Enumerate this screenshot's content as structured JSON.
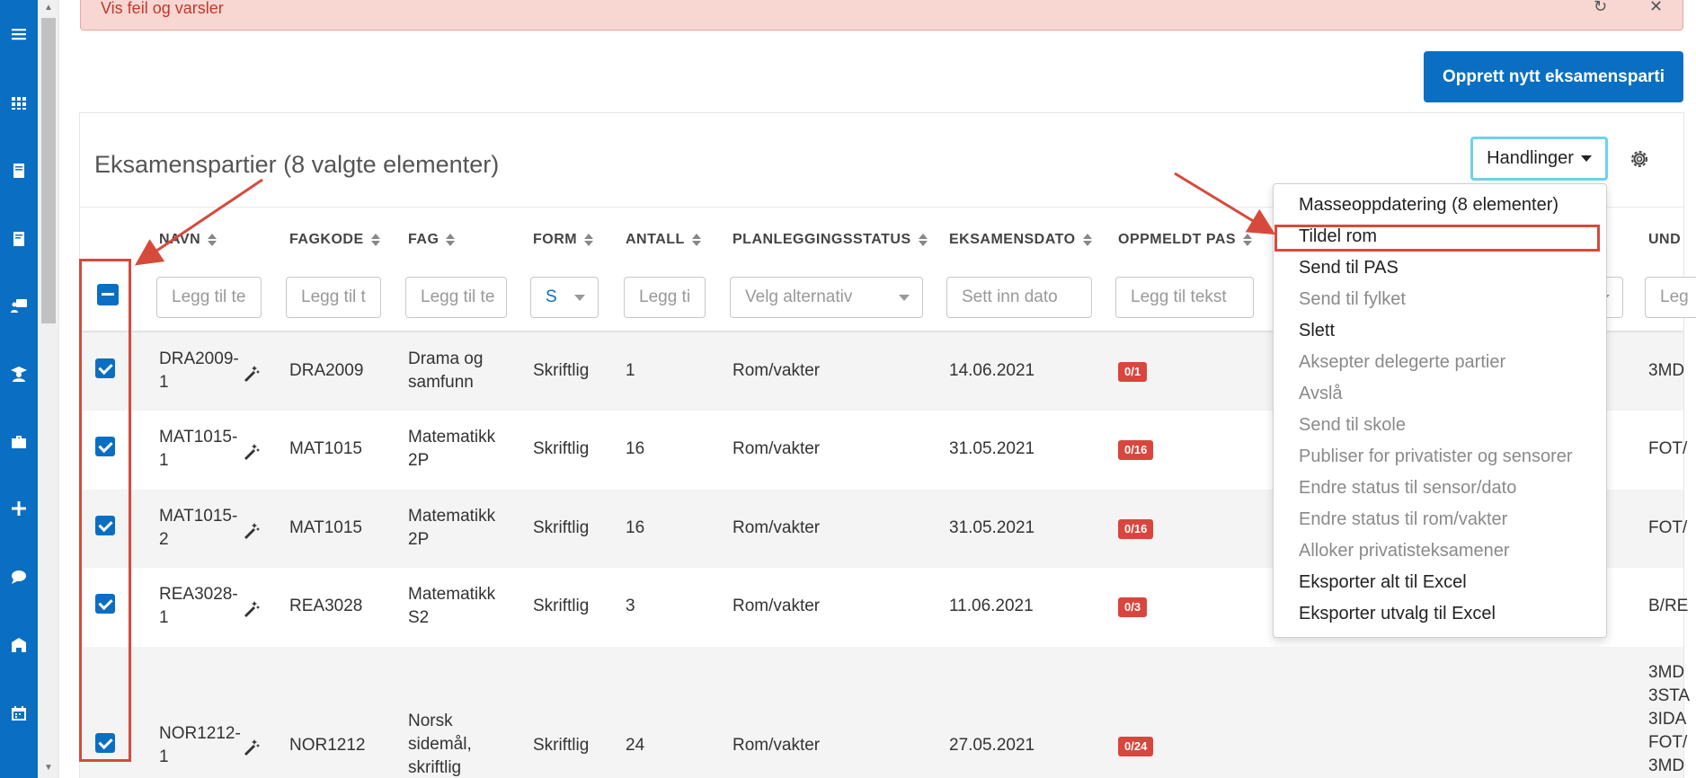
{
  "alert": {
    "text": "Vis feil og varsler"
  },
  "create_button": "Opprett nytt eksamensparti",
  "card": {
    "title": "Eksamenspartier (8 valgte elementer)"
  },
  "actions_button": "Handlinger",
  "columns": [
    "NAVN",
    "FAGKODE",
    "FAG",
    "FORM",
    "ANTALL",
    "PLANLEGGINGSSTATUS",
    "EKSAMENSDATO",
    "OPPMELDT PAS",
    "UND"
  ],
  "filters": {
    "navn": "Legg til te",
    "fagkode": "Legg til t",
    "fag": "Legg til te",
    "form": "S",
    "antall": "Legg ti",
    "status": "Velg alternativ",
    "dato": "Sett inn dato",
    "pas": "Legg til tekst",
    "und": "Leg"
  },
  "rows": [
    {
      "navn1": "DRA2009-",
      "navn2": "1",
      "fagkode": "DRA2009",
      "fag1": "Drama og",
      "fag2": "samfunn",
      "fag3": "",
      "form": "Skriftlig",
      "antall": "1",
      "status": "Rom/vakter",
      "dato": "14.06.2021",
      "pas": "0/1",
      "und": [
        "3MD"
      ]
    },
    {
      "navn1": "MAT1015-",
      "navn2": "1",
      "fagkode": "MAT1015",
      "fag1": "Matematikk",
      "fag2": "2P",
      "fag3": "",
      "form": "Skriftlig",
      "antall": "16",
      "status": "Rom/vakter",
      "dato": "31.05.2021",
      "pas": "0/16",
      "und": [
        "FOT/"
      ]
    },
    {
      "navn1": "MAT1015-",
      "navn2": "2",
      "fagkode": "MAT1015",
      "fag1": "Matematikk",
      "fag2": "2P",
      "fag3": "",
      "form": "Skriftlig",
      "antall": "16",
      "status": "Rom/vakter",
      "dato": "31.05.2021",
      "pas": "0/16",
      "und": [
        "FOT/"
      ]
    },
    {
      "navn1": "REA3028-",
      "navn2": "1",
      "fagkode": "REA3028",
      "fag1": "Matematikk",
      "fag2": "S2",
      "fag3": "",
      "form": "Skriftlig",
      "antall": "3",
      "status": "Rom/vakter",
      "dato": "11.06.2021",
      "pas": "0/3",
      "und": [
        "B/RE"
      ]
    },
    {
      "navn1": "NOR1212-",
      "navn2": "1",
      "fagkode": "NOR1212",
      "fag1": "Norsk",
      "fag2": "sidemål,",
      "fag3": "skriftlig",
      "form": "Skriftlig",
      "antall": "24",
      "status": "Rom/vakter",
      "dato": "27.05.2021",
      "pas": "0/24",
      "und": [
        "3MD",
        "3STA",
        "3IDA",
        "FOT/",
        "3MD"
      ]
    }
  ],
  "dropdown": [
    {
      "label": "Masseoppdatering (8 elementer)",
      "enabled": true
    },
    {
      "label": "Tildel rom",
      "enabled": true
    },
    {
      "label": "Send til PAS",
      "enabled": true
    },
    {
      "label": "Send til fylket",
      "enabled": false
    },
    {
      "label": "Slett",
      "enabled": true
    },
    {
      "label": "Aksepter delegerte partier",
      "enabled": false
    },
    {
      "label": "Avslå",
      "enabled": false
    },
    {
      "label": "Send til skole",
      "enabled": false
    },
    {
      "label": "Publiser for privatister og sensorer",
      "enabled": false
    },
    {
      "label": "Endre status til sensor/dato",
      "enabled": false
    },
    {
      "label": "Endre status til rom/vakter",
      "enabled": false
    },
    {
      "label": "Alloker privatisteksamener",
      "enabled": false
    },
    {
      "label": "Eksporter alt til Excel",
      "enabled": true
    },
    {
      "label": "Eksporter utvalg til Excel",
      "enabled": true
    }
  ],
  "sidebar_icons": [
    "menu-icon",
    "apps-grid-icon",
    "book-icon",
    "book-open-icon",
    "teacher-icon",
    "graduate-icon",
    "briefcase-icon",
    "plus-icon",
    "chat-icon",
    "school-icon",
    "calendar-icon"
  ],
  "colors": {
    "primary": "#0a6fc2",
    "badge": "#d9463d",
    "highlight": "#d64a3c",
    "focus": "#6dd3ea"
  }
}
